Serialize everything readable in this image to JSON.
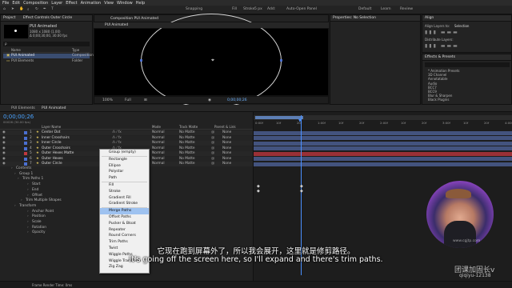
{
  "menubar": [
    "File",
    "Edit",
    "Composition",
    "Layer",
    "Effect",
    "Animation",
    "View",
    "Window",
    "Help"
  ],
  "toolbar": {
    "snapping": "Snapping",
    "fill": "Fill",
    "stroke": "Stroke",
    "stroke_width": "5 px",
    "add": "Add:",
    "auto_open": "Auto-Open Panel",
    "default": "Default",
    "learn": "Learn",
    "review": "Review"
  },
  "project": {
    "tab": "Project",
    "effect_controls_tab": "Effect Controls Outer Circle",
    "comp_name": "PUI Animated",
    "comp_info_1": "1080 x 1080 (1.00)",
    "comp_info_2": "Δ 0;00;30;00, 30.00 fps",
    "search_placeholder": "ρ",
    "col_name": "Name",
    "col_type": "Type",
    "items": [
      {
        "name": "PUI Animated",
        "type": "Composition"
      },
      {
        "name": "PUI Elements",
        "type": "Folder"
      }
    ]
  },
  "composition": {
    "tab": "Composition PUI Animated",
    "sub_tab": "PUI Animated"
  },
  "viewer_bar": {
    "zoom": "100%",
    "quality": "Full",
    "timecode": "0;00;00;26"
  },
  "properties": {
    "tab": "Properties: No Selection"
  },
  "align": {
    "title": "Align",
    "align_layers_to": "Align Layers to:",
    "align_value": "Selection",
    "distribute": "Distribute Layers:"
  },
  "effects": {
    "title": "Effects & Presets",
    "items": [
      "* Animation Presets",
      "3D Channel",
      "Annotatable",
      "Audio",
      "BCC7",
      "BCC9",
      "Blur & Sharpen",
      "Black Plugins"
    ]
  },
  "timeline": {
    "tabs": [
      "PUI Elements",
      "PUI Animated"
    ],
    "timecode": "0;00;00;26",
    "timecode_sub": "00026 (30.00 fps)",
    "columns": {
      "layer_name": "Layer Name",
      "mode": "Mode",
      "track_matte": "Track Matte",
      "parent_link": "Parent & Link"
    },
    "layers": [
      {
        "num": "1",
        "name": "Center Dot",
        "mode": "Normal",
        "matte": "No Matte",
        "parent": "None",
        "color": "#4a6fd0"
      },
      {
        "num": "2",
        "name": "Inner Crosshairs",
        "mode": "Normal",
        "matte": "No Matte",
        "parent": "None",
        "color": "#4a6fd0"
      },
      {
        "num": "3",
        "name": "Inner Circle",
        "mode": "Normal",
        "matte": "No Matte",
        "parent": "None",
        "color": "#4a6fd0"
      },
      {
        "num": "4",
        "name": "Outer Crosshairs",
        "mode": "Normal",
        "matte": "No Matte",
        "parent": "None",
        "color": "#4a6fd0"
      },
      {
        "num": "5",
        "name": "Outer Hexes Matte",
        "mode": "Normal",
        "matte": "No Matte",
        "parent": "None",
        "color": "#c0383e"
      },
      {
        "num": "6",
        "name": "Outer Hexes",
        "mode": "Normal",
        "matte": "No Matte",
        "parent": "None",
        "color": "#4a6fd0"
      },
      {
        "num": "7",
        "name": "Outer Circle",
        "mode": "Normal",
        "matte": "No Matte",
        "parent": "None",
        "color": "#4a6fd0"
      }
    ],
    "properties": [
      "Contents",
      "Group 1",
      "Trim Paths 1",
      "Start",
      "End",
      "Offset",
      "Trim Multiple Shapes",
      "Transform",
      "Anchor Point",
      "Position",
      "Scale",
      "Rotation",
      "Opacity"
    ],
    "ruler_ticks": [
      "0:00f",
      "10f",
      "20f",
      "1:00f",
      "10f",
      "20f",
      "2:00f",
      "10f",
      "20f",
      "3:00f",
      "10f",
      "20f",
      "4:00f"
    ],
    "footer": "Frame Render Time: 0ms"
  },
  "add_menu": {
    "items": [
      "Group (empty)",
      "-",
      "Rectangle",
      "Ellipse",
      "Polystar",
      "Path",
      "-",
      "Fill",
      "Stroke",
      "Gradient Fill",
      "Gradient Stroke",
      "-",
      "Merge Paths",
      "Offset Paths",
      "Pucker & Bloat",
      "Repeater",
      "Round Corners",
      "Trim Paths",
      "Twist",
      "Wiggle Paths",
      "Wiggle Transform",
      "Zig Zag"
    ],
    "highlighted": "Merge Paths"
  },
  "subtitles": {
    "zh": "它现在跑到屏幕外了，所以我会展开，这里就是修剪路径。",
    "en": "It's going off the screen here, so I'll expand and there's trim paths."
  },
  "watermark": {
    "line1": "团课加固长v",
    "line2": "qiqiyu-12138",
    "site": "www.cgjtp.com"
  },
  "colors": {
    "accent": "#4aa3ff",
    "layer_blue": "#4a6fd0",
    "layer_red": "#c0383e",
    "menu_highlight": "#9ec2f0",
    "playhead": "#4a90ff"
  }
}
